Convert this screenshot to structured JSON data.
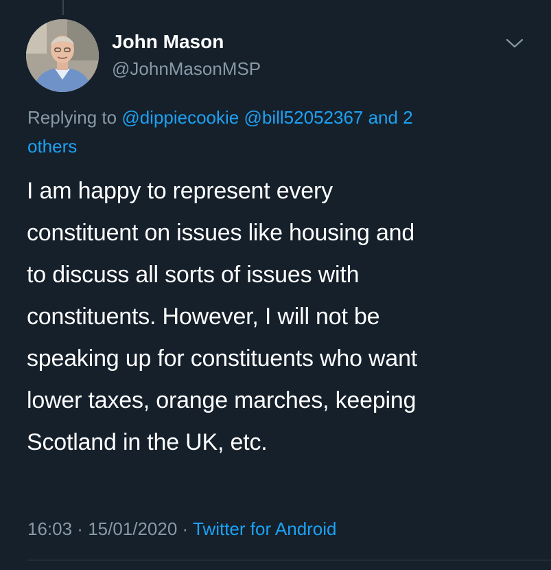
{
  "tweet": {
    "author": {
      "display_name": "John Mason",
      "handle": "@JohnMasonMSP"
    },
    "reply_context": {
      "prefix": "Replying to ",
      "mentions": [
        "@dippiecookie",
        "@bill52052367"
      ],
      "joiner": " ",
      "suffix_pre": " and 2",
      "suffix_post": "others"
    },
    "text_lines": [
      "I am happy to represent every",
      "constituent on issues like housing and",
      "to discuss all sorts of issues with",
      "constituents. However, I will not be",
      "speaking up for constituents who want",
      "lower taxes, orange marches, keeping",
      "Scotland in the UK, etc."
    ],
    "meta": {
      "time": "16:03",
      "separator": " · ",
      "date": "15/01/2020",
      "source": "Twitter for Android"
    }
  },
  "icons": {
    "menu": "chevron-down-icon",
    "avatar": "avatar"
  },
  "colors": {
    "background": "#15202b",
    "primary_text": "#ffffff",
    "secondary_text": "#8899a6",
    "accent": "#1da1f2",
    "divider": "#38444d"
  }
}
